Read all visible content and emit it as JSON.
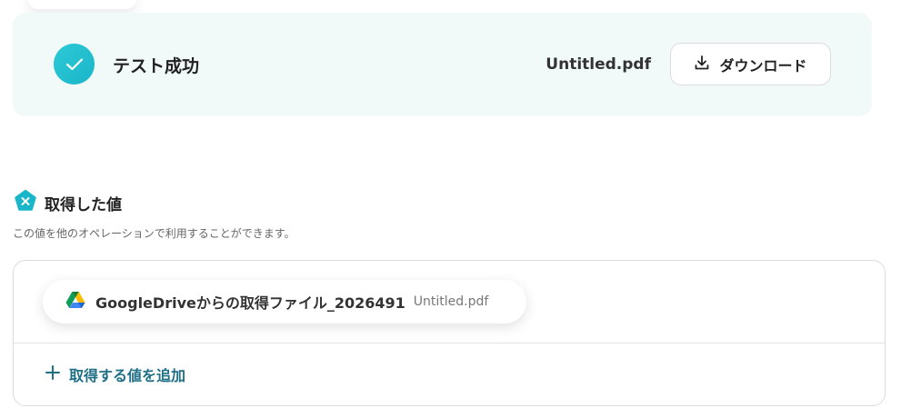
{
  "test_result": {
    "label": "テスト成功",
    "file_name": "Untitled.pdf",
    "download_label": "ダウンロード",
    "accent_color": "#19b6c9"
  },
  "acquired_values": {
    "title": "取得した値",
    "description": "この値を他のオペレーションで利用することができます。",
    "items": [
      {
        "name": "GoogleDriveからの取得ファイル_2026491",
        "value": "Untitled.pdf",
        "icon": "google-drive-icon"
      }
    ],
    "add_label": "取得する値を追加",
    "add_color": "#1f6f87"
  }
}
